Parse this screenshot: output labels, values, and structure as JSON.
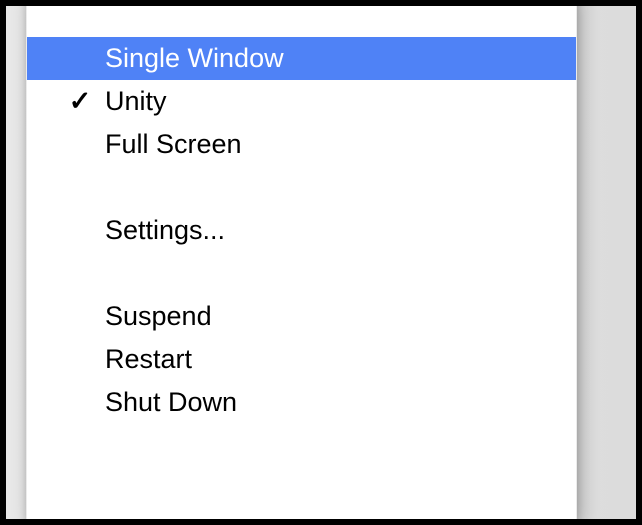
{
  "menu": {
    "items": [
      {
        "id": "single-window",
        "label": "Single Window",
        "checked": false,
        "highlighted": true
      },
      {
        "id": "unity",
        "label": "Unity",
        "checked": true,
        "highlighted": false
      },
      {
        "id": "full-screen",
        "label": "Full Screen",
        "checked": false,
        "highlighted": false
      },
      {
        "id": "settings",
        "label": "Settings...",
        "checked": false,
        "highlighted": false
      },
      {
        "id": "suspend",
        "label": "Suspend",
        "checked": false,
        "highlighted": false
      },
      {
        "id": "restart",
        "label": "Restart",
        "checked": false,
        "highlighted": false
      },
      {
        "id": "shut-down",
        "label": "Shut Down",
        "checked": false,
        "highlighted": false
      }
    ],
    "checkmark_glyph": "✓",
    "colors": {
      "highlight": "#4f82f6",
      "highlight_text": "#ffffff",
      "text": "#000000",
      "panel_bg": "#ffffff"
    }
  }
}
